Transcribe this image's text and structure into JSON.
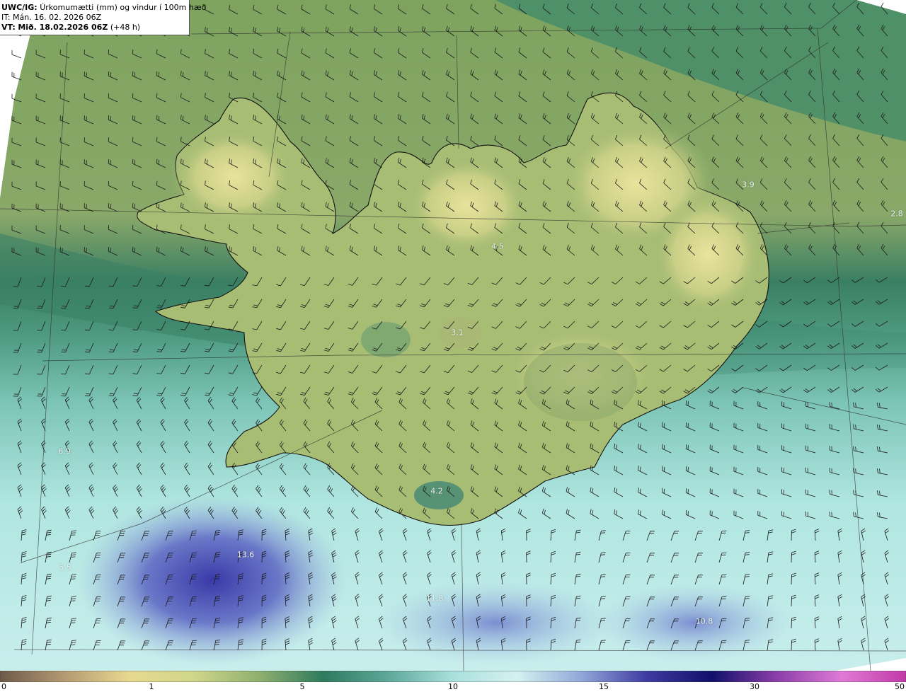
{
  "header": {
    "code": "UWC/IG:",
    "title": "Úrkomumætti (mm) og vindur í 100m hæð",
    "it_line": "IT: Mán. 16. 02. 2026 06Z",
    "vt_prefix": "VT:",
    "vt_date": "Mið. 18.02.2026 06Z",
    "vt_lead": "(+48 h)"
  },
  "map_values": [
    {
      "label": "3.9",
      "value": 3.9
    },
    {
      "label": "2.8",
      "value": 2.8
    },
    {
      "label": "4.5",
      "value": 4.5
    },
    {
      "label": "3.1",
      "value": 3.1
    },
    {
      "label": "6.9",
      "value": 6.9
    },
    {
      "label": "4.2",
      "value": 4.2
    },
    {
      "label": "13.6",
      "value": 13.6
    },
    {
      "label": "5.5",
      "value": 5.5
    },
    {
      "label": "11.8",
      "value": 11.8
    },
    {
      "label": "10.8",
      "value": 10.8
    }
  ],
  "colorbar": {
    "ticks": [
      "0",
      "1",
      "5",
      "10",
      "15",
      "30",
      "50"
    ],
    "stops": [
      "#6e5a4a",
      "#b49a72",
      "#e8d890",
      "#cfd68a",
      "#8fb06e",
      "#2e7a5e",
      "#5fa89a",
      "#a9e0dc",
      "#d4f1f0",
      "#8fa6d8",
      "#3e3aa0",
      "#12106a",
      "#8a3ea8",
      "#e07ad6",
      "#c23aa6"
    ]
  },
  "colors": {
    "land_low": "#7fa25e",
    "land_high": "#e5e29a",
    "sea_green": "#3e8c6c",
    "sea_cyan": "#b6ece6",
    "precip_blue": "#3a3aa8",
    "barb": "#1a1a1a",
    "coast": "#111111"
  }
}
